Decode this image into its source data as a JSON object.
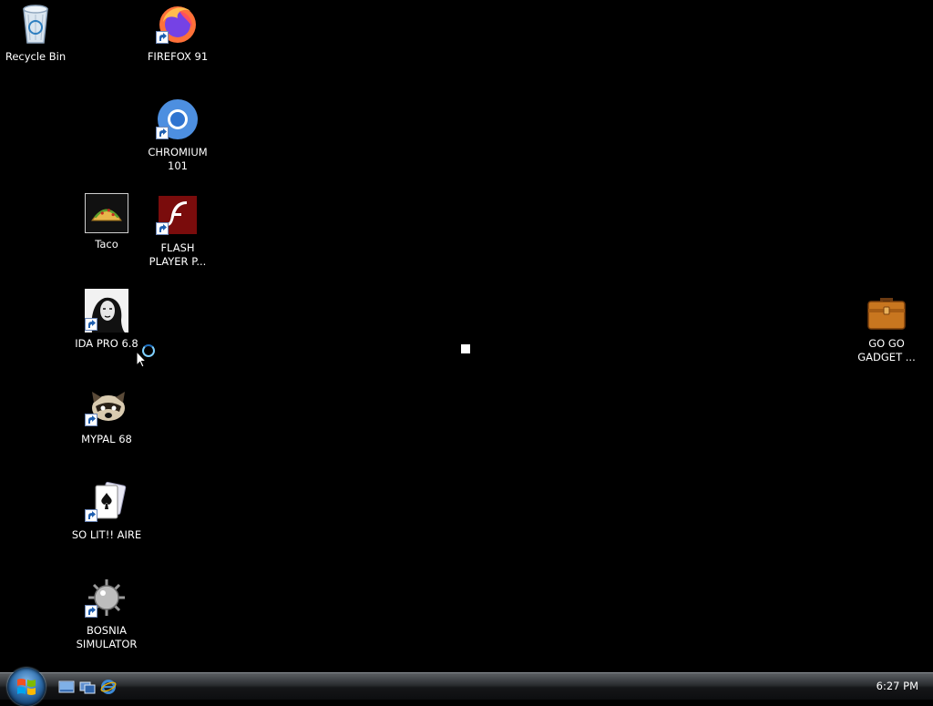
{
  "desktop": {
    "icons": {
      "recycle_bin": "Recycle Bin",
      "firefox": "FIREFOX 91",
      "chromium": "CHROMIUM\n101",
      "taco": "Taco",
      "flash": "FLASH\nPLAYER P...",
      "ida": "IDA PRO 6.8",
      "mypal": "MYPAL 68",
      "solitaire": "SO LIT!! AIRE",
      "bosnia": "BOSNIA\nSIMULATOR",
      "gogo": "GO GO\nGADGET ..."
    }
  },
  "taskbar": {
    "clock": "6:27 PM",
    "quick_launch": [
      "show-desktop-icon",
      "switch-windows-icon",
      "internet-explorer-icon"
    ]
  },
  "colors": {
    "desktop_bg": "#000000",
    "taskbar_top": "#5b5f63",
    "taskbar_bottom": "#0d0e10",
    "text": "#ffffff"
  }
}
